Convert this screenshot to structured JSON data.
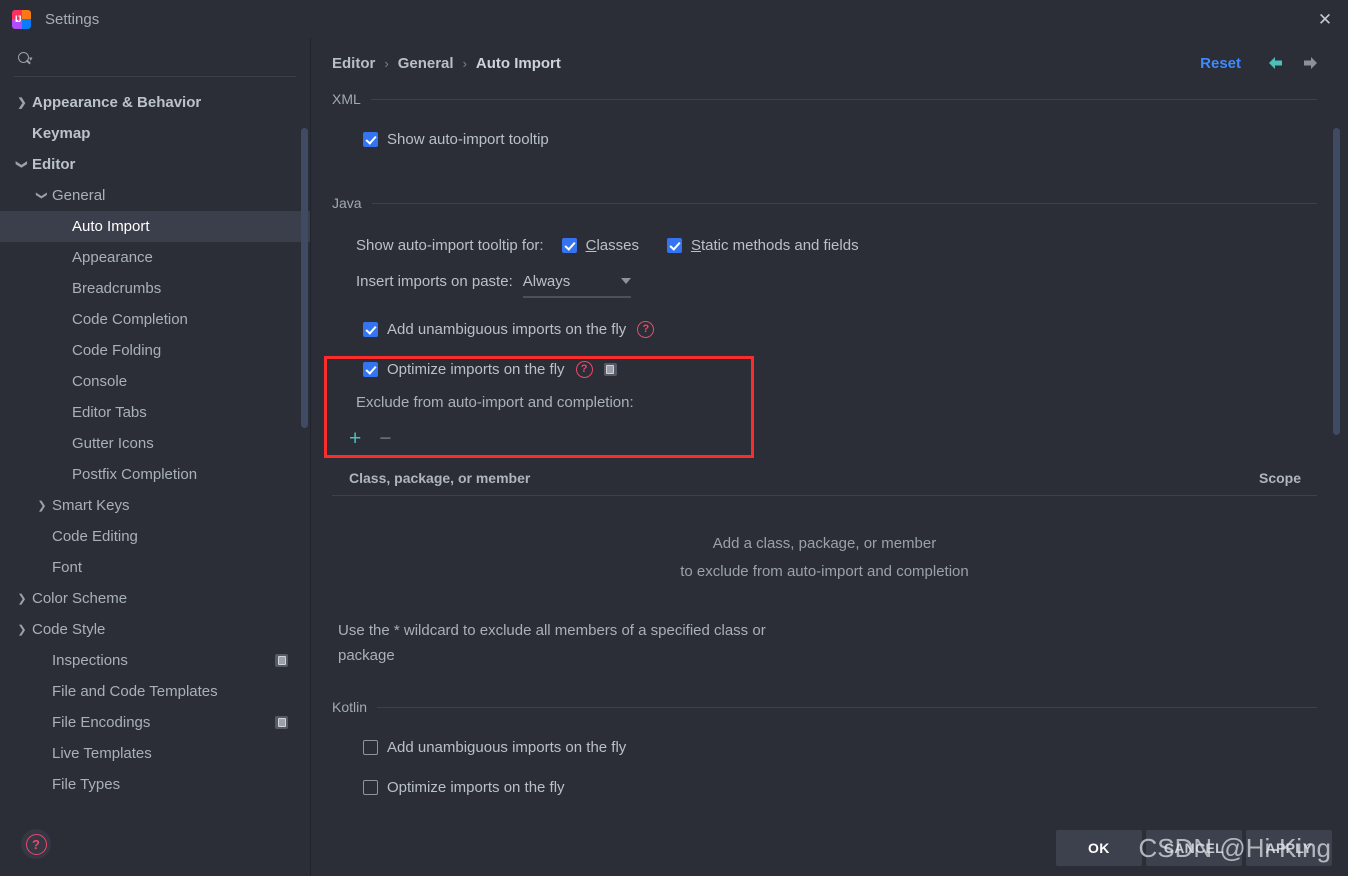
{
  "window": {
    "title": "Settings",
    "logo_icon": "intellij-idea-logo",
    "close_icon": "close-icon"
  },
  "sidebar": {
    "search": {
      "placeholder": "",
      "value": "",
      "icon": "search-icon"
    },
    "items": [
      {
        "label": "Appearance & Behavior",
        "indent": 0,
        "arrow": "collapsed",
        "bold": true,
        "selected": false,
        "badge": false
      },
      {
        "label": "Keymap",
        "indent": 0,
        "arrow": "none",
        "bold": true,
        "selected": false,
        "badge": false
      },
      {
        "label": "Editor",
        "indent": 0,
        "arrow": "expanded",
        "bold": true,
        "selected": false,
        "badge": false
      },
      {
        "label": "General",
        "indent": 1,
        "arrow": "expanded",
        "bold": false,
        "selected": false,
        "badge": false
      },
      {
        "label": "Auto Import",
        "indent": 2,
        "arrow": "none",
        "bold": false,
        "selected": true,
        "badge": false
      },
      {
        "label": "Appearance",
        "indent": 2,
        "arrow": "none",
        "bold": false,
        "selected": false,
        "badge": false
      },
      {
        "label": "Breadcrumbs",
        "indent": 2,
        "arrow": "none",
        "bold": false,
        "selected": false,
        "badge": false
      },
      {
        "label": "Code Completion",
        "indent": 2,
        "arrow": "none",
        "bold": false,
        "selected": false,
        "badge": false
      },
      {
        "label": "Code Folding",
        "indent": 2,
        "arrow": "none",
        "bold": false,
        "selected": false,
        "badge": false
      },
      {
        "label": "Console",
        "indent": 2,
        "arrow": "none",
        "bold": false,
        "selected": false,
        "badge": false
      },
      {
        "label": "Editor Tabs",
        "indent": 2,
        "arrow": "none",
        "bold": false,
        "selected": false,
        "badge": false
      },
      {
        "label": "Gutter Icons",
        "indent": 2,
        "arrow": "none",
        "bold": false,
        "selected": false,
        "badge": false
      },
      {
        "label": "Postfix Completion",
        "indent": 2,
        "arrow": "none",
        "bold": false,
        "selected": false,
        "badge": false
      },
      {
        "label": "Smart Keys",
        "indent": 1,
        "arrow": "collapsed",
        "bold": false,
        "selected": false,
        "badge": false
      },
      {
        "label": "Code Editing",
        "indent": 1,
        "arrow": "none",
        "bold": false,
        "selected": false,
        "badge": false
      },
      {
        "label": "Font",
        "indent": 1,
        "arrow": "none",
        "bold": false,
        "selected": false,
        "badge": false
      },
      {
        "label": "Color Scheme",
        "indent": 0,
        "arrow": "collapsed",
        "bold": false,
        "selected": false,
        "badge": false
      },
      {
        "label": "Code Style",
        "indent": 0,
        "arrow": "collapsed",
        "bold": false,
        "selected": false,
        "badge": false
      },
      {
        "label": "Inspections",
        "indent": 1,
        "arrow": "none",
        "bold": false,
        "selected": false,
        "badge": true
      },
      {
        "label": "File and Code Templates",
        "indent": 1,
        "arrow": "none",
        "bold": false,
        "selected": false,
        "badge": false
      },
      {
        "label": "File Encodings",
        "indent": 1,
        "arrow": "none",
        "bold": false,
        "selected": false,
        "badge": true
      },
      {
        "label": "Live Templates",
        "indent": 1,
        "arrow": "none",
        "bold": false,
        "selected": false,
        "badge": false
      },
      {
        "label": "File Types",
        "indent": 1,
        "arrow": "none",
        "bold": false,
        "selected": false,
        "badge": false
      }
    ]
  },
  "breadcrumb": {
    "items": [
      "Editor",
      "General",
      "Auto Import"
    ],
    "separator": "›",
    "reset_label": "Reset",
    "back_icon": "arrow-left-icon",
    "forward_icon": "arrow-right-icon"
  },
  "sections": {
    "xml": {
      "title": "XML",
      "show_tooltip": {
        "label": "Show auto-import tooltip",
        "checked": true
      }
    },
    "java": {
      "title": "Java",
      "tooltip_for_label": "Show auto-import tooltip for:",
      "tooltip_for_options": [
        {
          "label_pre": "",
          "mnemonic": "C",
          "label_post": "lasses",
          "checked": true
        },
        {
          "label_pre": "",
          "mnemonic": "S",
          "label_post": "tatic methods and fields",
          "checked": true
        }
      ],
      "insert_imports_label": "Insert imports on paste:",
      "insert_imports_value": "Always",
      "add_unambiguous": {
        "label": "Add unambiguous imports on the fly",
        "checked": true,
        "help": "?"
      },
      "optimize_imports": {
        "label": "Optimize imports on the fly",
        "checked": true,
        "help": "?",
        "badge": true
      },
      "exclude_label": "Exclude from auto-import and completion:",
      "add_button": "+",
      "remove_button": "−",
      "table_headers": [
        "Class, package, or member",
        "Scope"
      ],
      "table_rows": [],
      "empty_line1": "Add a class, package, or member",
      "empty_line2": "to exclude from auto-import and completion",
      "wildcard_hint": "Use the * wildcard to exclude all members of a specified class or package"
    },
    "kotlin": {
      "title": "Kotlin",
      "add_unambiguous": {
        "label": "Add unambiguous imports on the fly",
        "checked": false
      },
      "optimize_imports": {
        "label": "Optimize imports on the fly",
        "checked": false
      }
    }
  },
  "footer": {
    "help_icon": "question-mark-icon",
    "buttons": [
      {
        "label": "OK",
        "primary": true
      },
      {
        "label": "CANCEL",
        "primary": false
      },
      {
        "label": "APPLY",
        "primary": false
      }
    ]
  },
  "overlay": {
    "watermark": "CSDN @Hi-King",
    "highlight_color": "#fb2c2c"
  },
  "colors": {
    "background": "#2b2e37",
    "selection": "#3a3f4b",
    "accent_checkbox": "#3574f0",
    "link": "#3d8bff",
    "help_red": "#e84a6a",
    "teal": "#4dbfb8",
    "scrollbar": "#3f4a63"
  }
}
